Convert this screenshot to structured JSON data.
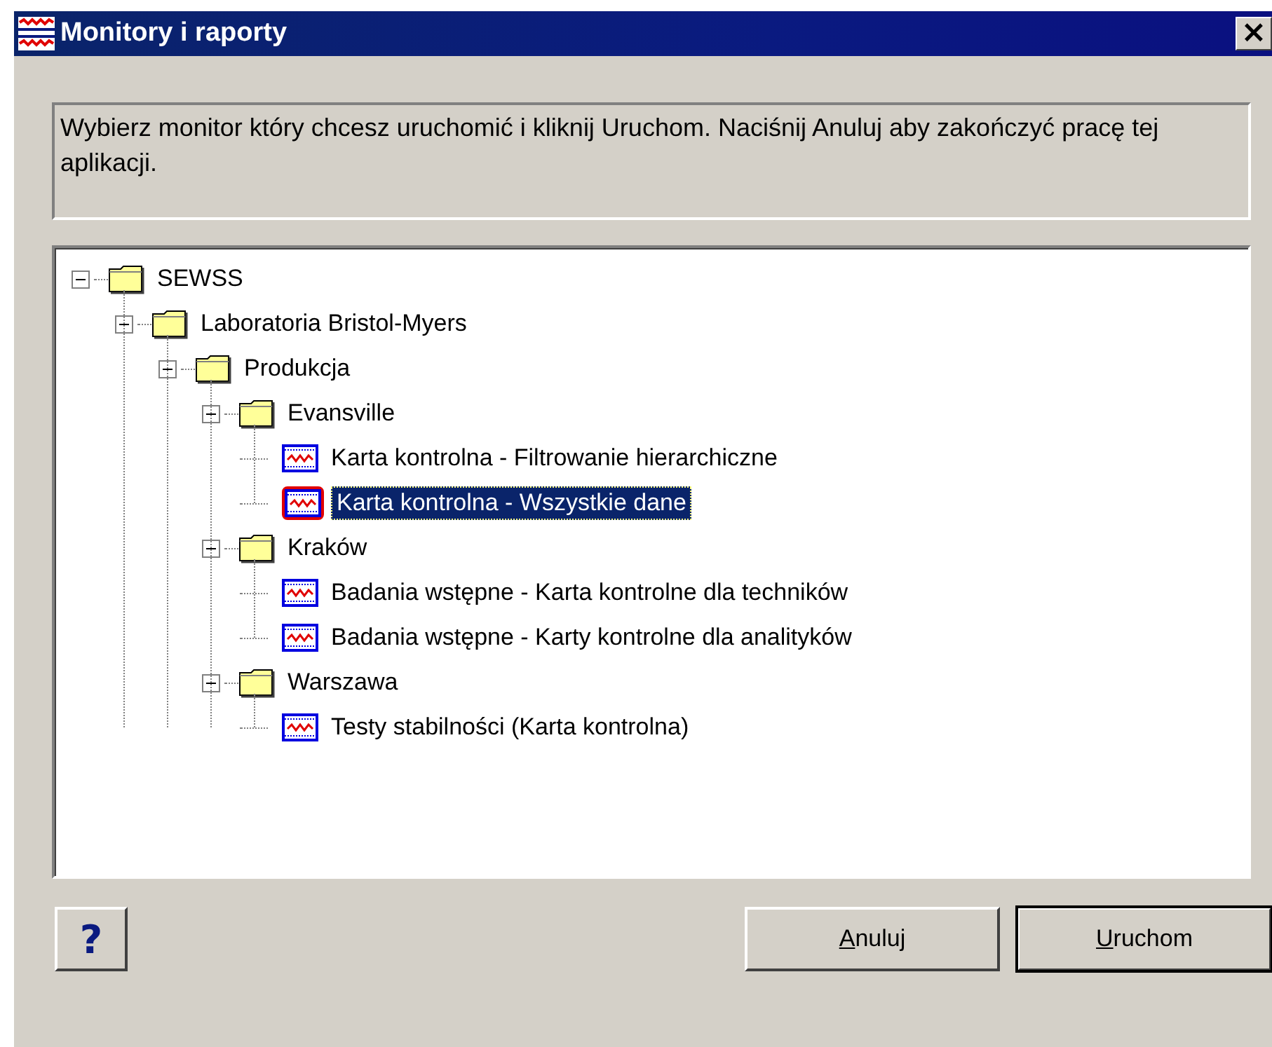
{
  "window": {
    "title": "Monitory i raporty",
    "close_label": "×"
  },
  "instructions": "Wybierz monitor który chcesz uruchomić i kliknij Uruchom. Naciśnij Anuluj aby zakończyć pracę tej aplikacji.",
  "tree": [
    {
      "kind": "folder",
      "label": "SEWSS",
      "expanded": true,
      "selected": false,
      "children": [
        {
          "kind": "folder",
          "label": "Laboratoria Bristol-Myers",
          "expanded": true,
          "selected": false,
          "children": [
            {
              "kind": "folder",
              "label": "Produkcja",
              "expanded": true,
              "selected": false,
              "children": [
                {
                  "kind": "folder",
                  "label": "Evansville",
                  "expanded": true,
                  "selected": false,
                  "children": [
                    {
                      "kind": "monitor",
                      "label": "Karta kontrolna - Filtrowanie hierarchiczne",
                      "selected": false
                    },
                    {
                      "kind": "monitor",
                      "label": "Karta kontrolna - Wszystkie dane",
                      "selected": true
                    }
                  ]
                },
                {
                  "kind": "folder",
                  "label": "Kraków",
                  "expanded": true,
                  "selected": false,
                  "children": [
                    {
                      "kind": "monitor",
                      "label": "Badania wstępne - Karta kontrolne dla techników",
                      "selected": false
                    },
                    {
                      "kind": "monitor",
                      "label": "Badania wstępne - Karty kontrolne dla analityków",
                      "selected": false
                    }
                  ]
                },
                {
                  "kind": "folder",
                  "label": "Warszawa",
                  "expanded": true,
                  "selected": false,
                  "children": [
                    {
                      "kind": "monitor",
                      "label": "Testy stabilności (Karta kontrolna)",
                      "selected": false
                    }
                  ]
                }
              ]
            }
          ]
        }
      ]
    }
  ],
  "help_button": {
    "label": "?"
  },
  "buttons": [
    {
      "label": "Anuluj",
      "underline_first": true,
      "default": false
    },
    {
      "label": "Uruchom",
      "underline_first": true,
      "default": true
    }
  ]
}
